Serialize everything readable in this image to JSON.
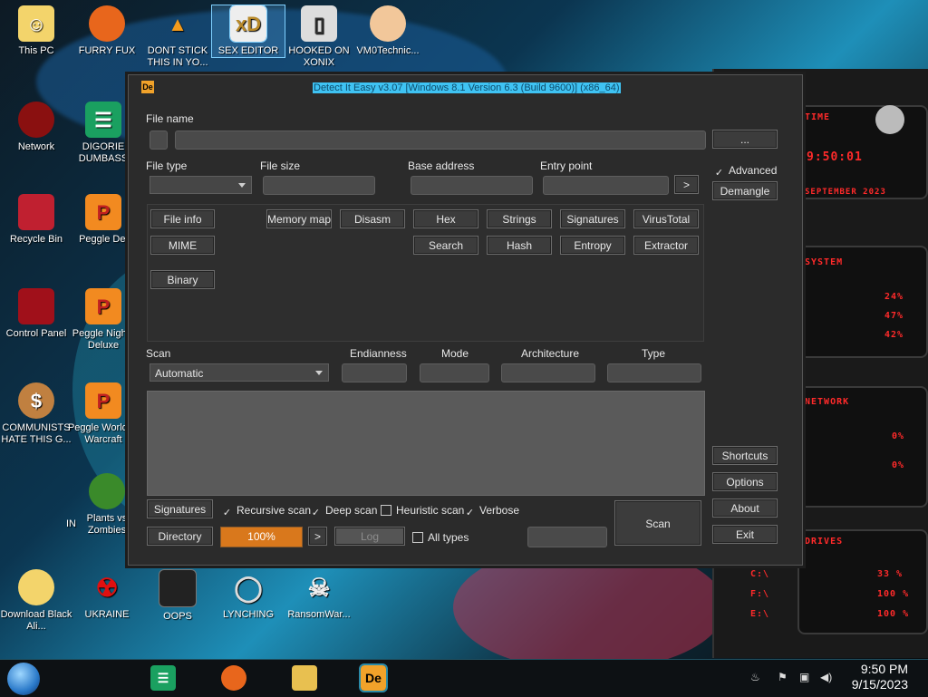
{
  "desktop": {
    "icons": [
      {
        "label": "This PC"
      },
      {
        "label": "FURRY FUX"
      },
      {
        "label": "DONT STICK THIS IN YO..."
      },
      {
        "label": "SEX EDITOR"
      },
      {
        "label": "HOOKED ON XONIX"
      },
      {
        "label": "VM0Technic..."
      },
      {
        "label": "Network"
      },
      {
        "label": "DIGORIE DUMBASS"
      },
      {
        "label": "Recycle Bin"
      },
      {
        "label": "Peggle Del"
      },
      {
        "label": "Control Panel"
      },
      {
        "label": "Peggle Nights Deluxe"
      },
      {
        "label": "COMMUNISTS HATE THIS G..."
      },
      {
        "label": "Peggle World of Warcraft"
      },
      {
        "label": "IN"
      },
      {
        "label": "Plants vs Zombies"
      },
      {
        "label": "Download Black Ali..."
      },
      {
        "label": "UKRAINE"
      },
      {
        "label": "OOPS"
      },
      {
        "label": "LYNCHING"
      },
      {
        "label": "RansomWar..."
      }
    ]
  },
  "window": {
    "title": "Detect It Easy v3.07 [Windows 8.1 Version 6.3 (Build 9600)] (x86_64)",
    "file_name_label": "File name",
    "browse_label": "...",
    "file_type_label": "File type",
    "file_size_label": "File size",
    "base_address_label": "Base address",
    "entry_point_label": "Entry point",
    "entry_arrow": ">",
    "advanced_label": "Advanced",
    "demangle_label": "Demangle",
    "buttons_row1": [
      "File info",
      "Memory map",
      "Disasm",
      "Hex",
      "Strings",
      "Signatures",
      "VirusTotal"
    ],
    "buttons_row2": [
      "MIME",
      "Search",
      "Hash",
      "Entropy",
      "Extractor"
    ],
    "binary_label": "Binary",
    "scan_label": "Scan",
    "endianness_label": "Endianness",
    "mode_label": "Mode",
    "architecture_label": "Architecture",
    "type_label": "Type",
    "scan_mode_value": "Automatic",
    "shortcuts_label": "Shortcuts",
    "options_label": "Options",
    "about_label": "About",
    "exit_label": "Exit",
    "signatures_label": "Signatures",
    "directory_label": "Directory",
    "recursive_scan_label": "Recursive scan",
    "deep_scan_label": "Deep scan",
    "heuristic_scan_label": "Heuristic scan",
    "verbose_label": "Verbose",
    "progress_text": "100%",
    "progress_arrow": ">",
    "log_label": "Log",
    "all_types_label": "All types",
    "scan_button_label": "Scan",
    "recursive_checked": true,
    "deep_checked": true,
    "heuristic_checked": false,
    "verbose_checked": true,
    "all_types_checked": false,
    "advanced_checked": true
  },
  "sidepanel": {
    "time_header": "TIME",
    "time": "9:50:01",
    "date": "SEPTEMBER 2023",
    "system_header": "SYSTEM",
    "cpu1": "24%",
    "cpu2": "47%",
    "cpu3": "42%",
    "network_header": "NETWORK",
    "net1": "0%",
    "net2": "0%",
    "drives_header": "DRIVES",
    "drives": [
      {
        "name": "C:\\",
        "value": "33 %"
      },
      {
        "name": "F:\\",
        "value": "100 %"
      },
      {
        "name": "E:\\",
        "value": "100 %"
      }
    ]
  },
  "taskbar": {
    "time": "9:50 PM",
    "date": "9/15/2023"
  },
  "colors": {
    "accent": "#3fc3f3",
    "progress": "#d9781c",
    "panel_red": "#ff2a2a"
  }
}
